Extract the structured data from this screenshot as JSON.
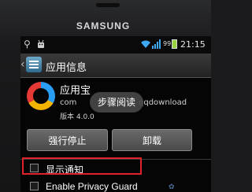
{
  "device": {
    "brand": "SAMSUNG"
  },
  "status_bar": {
    "battery": "99",
    "time": "21:15",
    "icons": [
      "usb-icon",
      "android-debug-icon",
      "wifi-icon",
      "signal-icon",
      "battery-icon"
    ]
  },
  "title_bar": {
    "title": "应用信息"
  },
  "app": {
    "name": "应用宝",
    "package_head": "com",
    "package_tail": "qqdownload",
    "version": "版本 4.0.0"
  },
  "tooltip": {
    "text": "步骤阅读"
  },
  "buttons": {
    "force_stop": "强行停止",
    "uninstall": "卸载"
  },
  "options": [
    {
      "label": "显示通知",
      "checked": false
    },
    {
      "label": "Enable Privacy Guard",
      "checked": false
    }
  ],
  "colors": {
    "highlight": "#e0222c",
    "battery": "#9ad23f"
  }
}
